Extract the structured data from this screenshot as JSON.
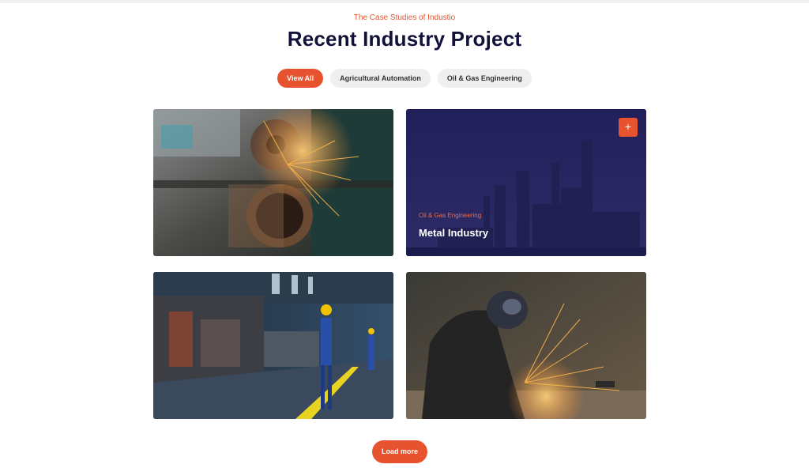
{
  "header": {
    "eyebrow": "The Case Studies of Industio",
    "title": "Recent Industry Project"
  },
  "filters": [
    {
      "label": "View All",
      "active": true
    },
    {
      "label": "Agricultural Automation",
      "active": false
    },
    {
      "label": "Oil & Gas Engineering",
      "active": false
    }
  ],
  "cards": [
    {
      "image": "pipe-grinding-photo"
    },
    {
      "image": "refinery-photo",
      "category": "Oil & Gas Engineering",
      "title": "Metal Industry",
      "action_icon": "plus-icon",
      "action_symbol": "+"
    },
    {
      "image": "steel-mill-worker-photo"
    },
    {
      "image": "welder-sparks-photo"
    }
  ],
  "load_more_label": "Load more",
  "colors": {
    "accent": "#e8532f",
    "heading": "#12113a",
    "pill_bg": "#efefef"
  }
}
